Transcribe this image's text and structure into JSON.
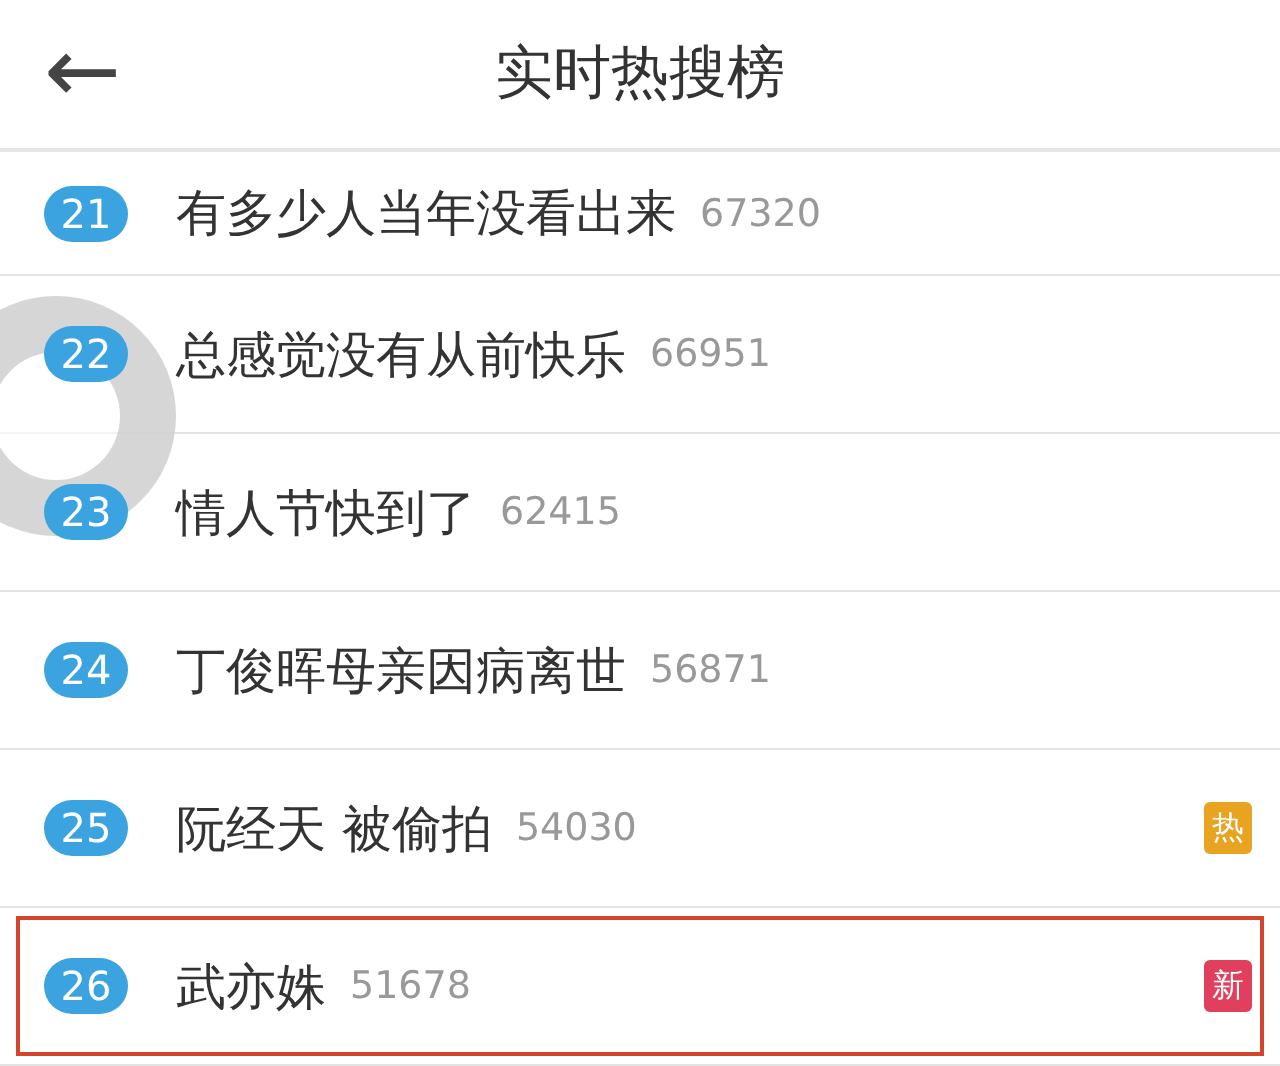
{
  "header": {
    "back_icon": "←",
    "title": "实时热搜榜"
  },
  "rows": [
    {
      "rank": "21",
      "title": "有多少人当年没看出来",
      "count": "67320",
      "highlighted": false
    },
    {
      "rank": "22",
      "title": "总感觉没有从前快乐",
      "count": "66951",
      "highlighted": false
    },
    {
      "rank": "23",
      "title": "情人节快到了",
      "count": "62415",
      "highlighted": false
    },
    {
      "rank": "24",
      "title": "丁俊晖母亲因病离世",
      "count": "56871",
      "highlighted": false
    },
    {
      "rank": "25",
      "title": "阮经天 被偷拍",
      "count": "54030",
      "highlighted": false,
      "tag": {
        "text": "热",
        "color": "#e8a321"
      }
    },
    {
      "rank": "26",
      "title": "武亦姝",
      "count": "51678",
      "highlighted": true,
      "tag": {
        "text": "新",
        "color": "#e0405e"
      }
    }
  ]
}
